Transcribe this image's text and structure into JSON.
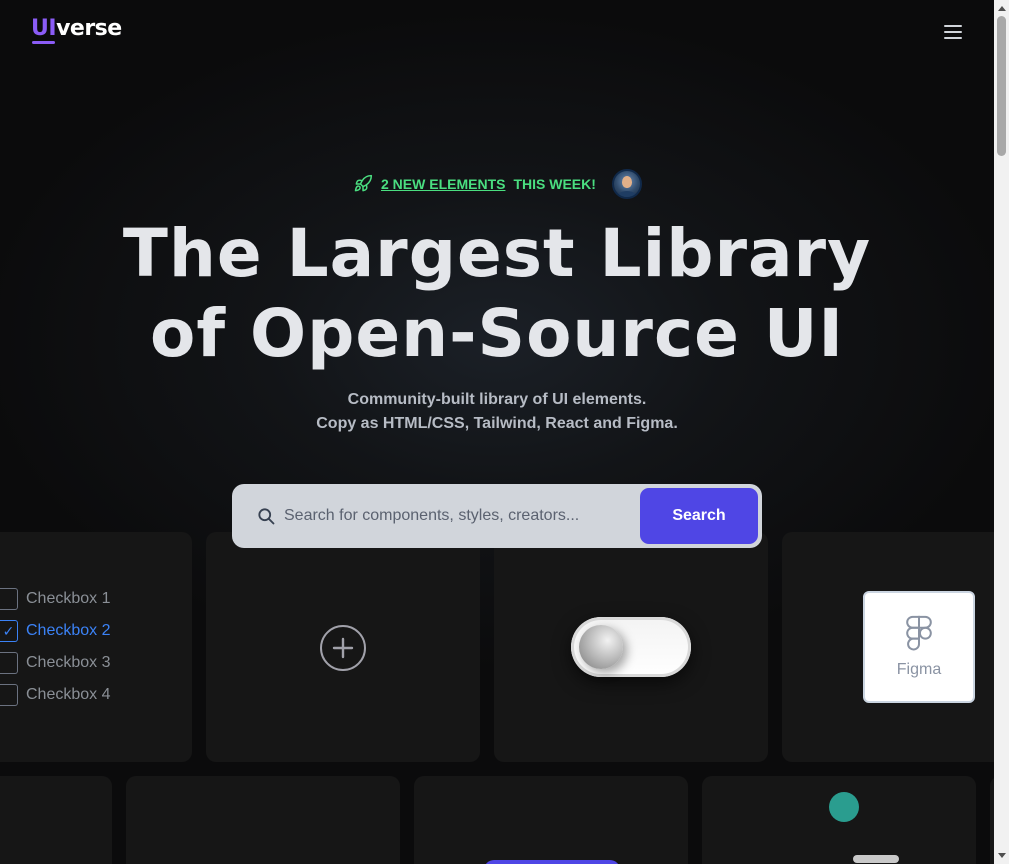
{
  "header": {
    "logo_ui": "UI",
    "logo_verse": "verse",
    "menu_icon": "hamburger-menu-icon"
  },
  "announcement": {
    "icon": "rocket-icon",
    "link_text": "2 NEW ELEMENTS",
    "rest_text": " THIS WEEK!",
    "accent_color": "#4ade80"
  },
  "hero": {
    "title_line1": "The Largest Library",
    "title_line2": "of Open-Source UI",
    "subtitle_line1": "Community-built library of UI elements.",
    "subtitle_line2": "Copy as HTML/CSS, Tailwind, React and Figma."
  },
  "search": {
    "placeholder": "Search for components, styles, creators...",
    "value": "",
    "button_label": "Search",
    "button_color": "#4f46e5"
  },
  "showcase": {
    "checkboxes": [
      {
        "label": "Checkbox 1",
        "checked": false
      },
      {
        "label": "Checkbox 2",
        "checked": true
      },
      {
        "label": "Checkbox 3",
        "checked": false
      },
      {
        "label": "Checkbox 4",
        "checked": false
      }
    ],
    "checked_color": "#3b82f6",
    "plus_icon": "plus-circle-icon",
    "toggle_state": "off",
    "figma_label": "Figma",
    "figma_icon": "figma-icon"
  }
}
